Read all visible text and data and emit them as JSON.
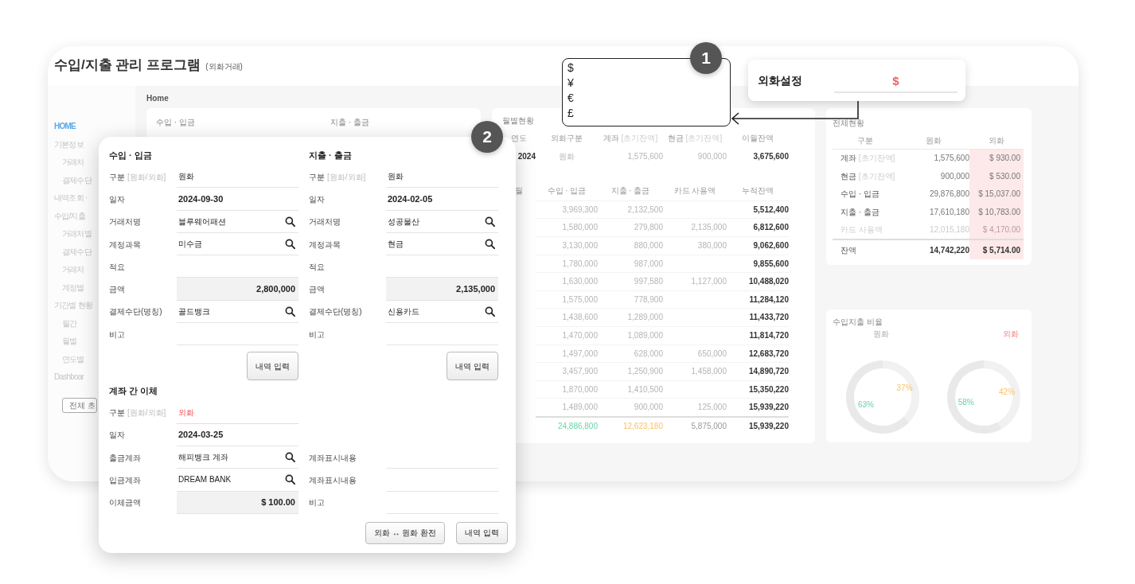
{
  "app": {
    "title": "수입/지출 관리 프로그램",
    "subtitle": "(외화거래)"
  },
  "sidebar": {
    "items": [
      {
        "label": "HOME",
        "selected": true
      },
      {
        "label": "기본정보",
        "selected": false,
        "children": [
          {
            "label": "거래처",
            "selected": false
          },
          {
            "label": "결제수단",
            "selected": false
          }
        ]
      },
      {
        "label": "내역조회 ·",
        "selected": false
      },
      {
        "label": "수입/지출",
        "selected": false,
        "children": [
          {
            "label": "거래처별",
            "selected": false
          },
          {
            "label": "결제수단",
            "selected": false
          },
          {
            "label": "거래처",
            "selected": false
          },
          {
            "label": "계정별",
            "selected": false
          }
        ]
      },
      {
        "label": "기간별 현황",
        "selected": false,
        "children": [
          {
            "label": "월간",
            "selected": false
          },
          {
            "label": "월별",
            "selected": false
          },
          {
            "label": "연도별",
            "selected": false
          }
        ]
      },
      {
        "label": "Dashboar",
        "selected": false
      }
    ],
    "button": "전체 초"
  },
  "breadcrumb": "Home",
  "background_form": {
    "titles": [
      "수입 · 입금",
      "지출 · 출금"
    ]
  },
  "monthly": {
    "title": "월별현황",
    "year_table": {
      "columns": [
        {
          "label": "연도"
        },
        {
          "label": "외화구분"
        },
        {
          "label": "계좌",
          "note": "[초기잔액]"
        },
        {
          "label": "현금",
          "note": "[초기잔액]"
        },
        {
          "label": "이월잔액"
        }
      ],
      "row": [
        "2024",
        "원화",
        "1,575,600",
        "900,000",
        "3,675,600"
      ]
    },
    "month_table": {
      "columns": [
        "월",
        "수입 · 입금",
        "지출 · 출금",
        "카드 사용액",
        "누적잔액"
      ],
      "rows": [
        {
          "income": "3,969,300",
          "expense": "2,132,500",
          "balance": "5,512,400"
        },
        {
          "income": "1,580,000",
          "expense": "279,800",
          "card": "2,135,000",
          "balance": "6,812,600"
        },
        {
          "income": "3,130,000",
          "expense": "880,000",
          "card": "380,000",
          "balance": "9,062,600"
        },
        {
          "income": "1,780,000",
          "expense": "987,000",
          "balance": "9,855,600"
        },
        {
          "income": "1,630,000",
          "expense": "997,580",
          "card": "1,127,000",
          "balance": "10,488,020"
        },
        {
          "income": "1,575,000",
          "expense": "778,900",
          "balance": "11,284,120"
        },
        {
          "income": "1,438,600",
          "expense": "1,289,000",
          "balance": "11,433,720"
        },
        {
          "income": "1,470,000",
          "expense": "1,089,000",
          "balance": "11,814,720"
        },
        {
          "income": "1,497,000",
          "expense": "628,000",
          "card": "650,000",
          "balance": "12,683,720"
        },
        {
          "income": "3,457,900",
          "expense": "1,250,900",
          "card": "1,458,000",
          "balance": "14,890,720"
        },
        {
          "income": "1,870,000",
          "expense": "1,410,500",
          "balance": "15,350,220"
        },
        {
          "income": "1,489,000",
          "expense": "900,000",
          "card": "125,000",
          "balance": "15,939,220"
        }
      ],
      "total": {
        "income": "24,886,800",
        "expense": "12,623,180",
        "card": "5,875,000",
        "balance": "15,939,220"
      }
    }
  },
  "summary": {
    "title": "전체현황",
    "columns": [
      "구분",
      "원화",
      "외화"
    ],
    "rows": [
      {
        "label": "계좌",
        "note": "[초기잔액]",
        "krw": "1,575,600",
        "foreign": "$ 930.00",
        "muted": false
      },
      {
        "label": "현금",
        "note": "[초기잔액]",
        "krw": "900,000",
        "foreign": "$ 530.00",
        "muted": false
      },
      {
        "label": "수입 · 입금",
        "krw": "29,876,800",
        "foreign": "$ 15,037.00",
        "muted": false
      },
      {
        "label": "지출 · 출금",
        "krw": "17,610,180",
        "foreign": "$ 10,783.00",
        "muted": false
      },
      {
        "label": "카드 사용액",
        "krw": "12,015,180",
        "foreign": "$ 4,170.00",
        "muted": true
      }
    ],
    "total": {
      "label": "잔액",
      "krw": "14,742,220",
      "foreign": "$ 5,714.00"
    }
  },
  "ratio": {
    "title": "수입지출 비율",
    "charts": [
      {
        "label": "원화",
        "foreign": false,
        "chart_data": {
          "type": "donut",
          "values": [
            63,
            37
          ],
          "value_labels": [
            "63%",
            "37%"
          ]
        }
      },
      {
        "label": "외화",
        "foreign": true,
        "chart_data": {
          "type": "donut",
          "values": [
            58,
            42
          ],
          "value_labels": [
            "58%",
            "42%"
          ]
        }
      }
    ]
  },
  "currency_options": [
    "$",
    "¥",
    "€",
    "£"
  ],
  "currency_setting": {
    "label": "외화설정",
    "value": "$"
  },
  "callouts": [
    "1",
    "2"
  ],
  "entry_form": {
    "sections": [
      {
        "title": "수입 · 입금",
        "button": "내역 입력",
        "fields": [
          {
            "label": "구분",
            "note": "[원화/외화]",
            "kind": "plain",
            "value": "원화",
            "alert": false
          },
          {
            "label": "일자",
            "kind": "date",
            "value": "2024-09-30",
            "alert": false
          },
          {
            "label": "거래처명",
            "kind": "search",
            "value": "블루웨어패션",
            "alert": false
          },
          {
            "label": "계정과목",
            "kind": "search",
            "value": "미수금",
            "alert": false
          },
          {
            "label": "적요",
            "kind": "plain",
            "alert": false
          },
          {
            "label": "금액",
            "kind": "amount",
            "value": "2,800,000",
            "alert": false
          },
          {
            "label": "결제수단(명칭)",
            "kind": "search",
            "value": "골드뱅크",
            "alert": false
          },
          {
            "label": "비고",
            "kind": "plain",
            "alert": false
          }
        ]
      },
      {
        "title": "지출 · 출금",
        "button": "내역 입력",
        "fields": [
          {
            "label": "구분",
            "note": "[원화/외화]",
            "kind": "plain",
            "value": "원화",
            "alert": false
          },
          {
            "label": "일자",
            "kind": "date",
            "value": "2024-02-05",
            "alert": false
          },
          {
            "label": "거래처명",
            "kind": "search",
            "value": "성공물산",
            "alert": false
          },
          {
            "label": "계정과목",
            "kind": "search",
            "value": "현금",
            "alert": false
          },
          {
            "label": "적요",
            "kind": "plain",
            "alert": false
          },
          {
            "label": "금액",
            "kind": "amount",
            "value": "2,135,000",
            "alert": false
          },
          {
            "label": "결제수단(명칭)",
            "kind": "search",
            "value": "신용카드",
            "alert": false
          },
          {
            "label": "비고",
            "kind": "plain",
            "alert": false
          }
        ]
      }
    ],
    "transfer": {
      "title": "계좌 간 이체",
      "fields": [
        {
          "label": "구분",
          "note": "[원화/외화]",
          "kind": "plain",
          "value": "외화",
          "alert": true
        },
        {
          "label": "일자",
          "kind": "date",
          "value": "2024-03-25",
          "alert": false
        },
        {
          "label": "출금계좌",
          "kind": "search",
          "value": "해피뱅크 계좌",
          "alert": false
        },
        {
          "label": "입금계좌",
          "kind": "search",
          "value": "DREAM BANK",
          "alert": false
        },
        {
          "label": "이체금액",
          "kind": "amount",
          "value": "$ 100.00",
          "alert": false
        }
      ],
      "side_fields": [
        {
          "label": "계좌표시내용",
          "alert": false
        },
        {
          "label": "계좌표시내용",
          "alert": false
        },
        {
          "label": "비고",
          "alert": false
        }
      ]
    },
    "buttons": [
      "외화 ↔ 원화 환전",
      "내역 입력"
    ]
  }
}
